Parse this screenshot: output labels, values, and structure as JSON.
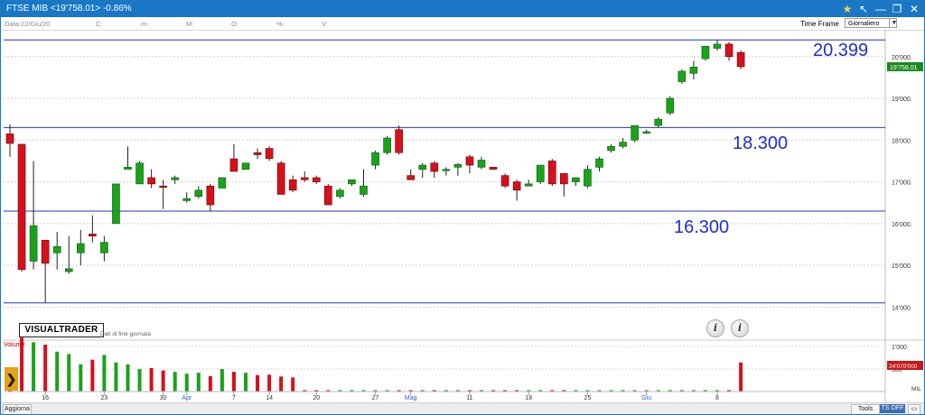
{
  "window": {
    "title": "FTSE MIB <19'758.01> -0.86%",
    "buttons": {
      "star": "★",
      "back": "↖",
      "minimize": "—",
      "restore": "❐",
      "close": "✕"
    }
  },
  "infobar": {
    "date": "Data:22/Giu/20",
    "close": "C:",
    "min": "m:",
    "max": "M:",
    "open": "O:",
    "pct": "%:",
    "vol": "V:"
  },
  "timeframe": {
    "label": "Time Frame",
    "value": "Giornaliero"
  },
  "logo": {
    "text": "VISUALTRADER",
    "subtitle": "Dati di fine giornata"
  },
  "info_buttons": [
    "i",
    "i"
  ],
  "levels": [
    {
      "value": 20399,
      "label": "20.399"
    },
    {
      "value": 18300,
      "label": "18.300"
    },
    {
      "value": 16300,
      "label": "16.300"
    },
    {
      "value": 14100,
      "label": ""
    }
  ],
  "price_axis": {
    "ticks": [
      {
        "v": 20000,
        "label": "20'000."
      },
      {
        "v": 19000,
        "label": "19'000."
      },
      {
        "v": 18000,
        "label": "18'000."
      },
      {
        "v": 17000,
        "label": "17'000."
      },
      {
        "v": 16000,
        "label": "16'000."
      },
      {
        "v": 15000,
        "label": "15'000."
      },
      {
        "v": 14000,
        "label": "14'000."
      }
    ],
    "last_price": "19'758.01"
  },
  "volume_axis": {
    "label": "Volume",
    "ticks": [
      "1'000",
      "500"
    ],
    "unit": "MIL",
    "last_volume": "24'070'000"
  },
  "x_labels": [
    "16",
    "23",
    "30",
    "Apr",
    "7",
    "14",
    "20",
    "27",
    "Mag",
    "11",
    "18",
    "25",
    "Giu",
    "8"
  ],
  "bottombar": {
    "update": "Aggiorna",
    "tools": "Tools",
    "ts": "TS OFF",
    "more": "▭"
  },
  "side_arrow": "❯",
  "chart_data": {
    "type": "candlestick",
    "title": "FTSE MIB",
    "ylim": [
      13900,
      20600
    ],
    "candles": [
      {
        "o": 18150,
        "h": 18380,
        "l": 17600,
        "c": 17920
      },
      {
        "o": 17900,
        "h": 17900,
        "l": 14850,
        "c": 14900
      },
      {
        "o": 15100,
        "h": 17500,
        "l": 14900,
        "c": 15950
      },
      {
        "o": 15600,
        "h": 15600,
        "l": 14100,
        "c": 15050
      },
      {
        "o": 15300,
        "h": 15800,
        "l": 14900,
        "c": 15450
      },
      {
        "o": 14850,
        "h": 15700,
        "l": 14800,
        "c": 14920
      },
      {
        "o": 15300,
        "h": 15850,
        "l": 15000,
        "c": 15520
      },
      {
        "o": 15750,
        "h": 16200,
        "l": 15550,
        "c": 15700
      },
      {
        "o": 15300,
        "h": 15700,
        "l": 15100,
        "c": 15550
      },
      {
        "o": 16000,
        "h": 16950,
        "l": 16000,
        "c": 16950
      },
      {
        "o": 17300,
        "h": 17850,
        "l": 17300,
        "c": 17350
      },
      {
        "o": 16950,
        "h": 17500,
        "l": 16950,
        "c": 17450
      },
      {
        "o": 17100,
        "h": 17300,
        "l": 16850,
        "c": 16950
      },
      {
        "o": 16900,
        "h": 17050,
        "l": 16350,
        "c": 16870
      },
      {
        "o": 17050,
        "h": 17150,
        "l": 16950,
        "c": 17100
      },
      {
        "o": 16550,
        "h": 16750,
        "l": 16500,
        "c": 16600
      },
      {
        "o": 16650,
        "h": 16900,
        "l": 16600,
        "c": 16800
      },
      {
        "o": 16900,
        "h": 16950,
        "l": 16300,
        "c": 16450
      },
      {
        "o": 16850,
        "h": 17100,
        "l": 16850,
        "c": 17100
      },
      {
        "o": 17550,
        "h": 17900,
        "l": 17300,
        "c": 17250
      },
      {
        "o": 17300,
        "h": 17450,
        "l": 17300,
        "c": 17450
      },
      {
        "o": 17700,
        "h": 17800,
        "l": 17550,
        "c": 17650
      },
      {
        "o": 17800,
        "h": 17850,
        "l": 17500,
        "c": 17560
      },
      {
        "o": 17450,
        "h": 17500,
        "l": 16700,
        "c": 16700
      },
      {
        "o": 17050,
        "h": 17150,
        "l": 16750,
        "c": 16800
      },
      {
        "o": 17100,
        "h": 17250,
        "l": 17000,
        "c": 17050
      },
      {
        "o": 17100,
        "h": 17150,
        "l": 16950,
        "c": 17000
      },
      {
        "o": 16900,
        "h": 16950,
        "l": 16450,
        "c": 16450
      },
      {
        "o": 16650,
        "h": 16850,
        "l": 16600,
        "c": 16800
      },
      {
        "o": 16950,
        "h": 17050,
        "l": 16900,
        "c": 17050
      },
      {
        "o": 16700,
        "h": 17300,
        "l": 16650,
        "c": 16900
      },
      {
        "o": 17400,
        "h": 17750,
        "l": 17300,
        "c": 17700
      },
      {
        "o": 17700,
        "h": 18100,
        "l": 17650,
        "c": 18050
      },
      {
        "o": 18250,
        "h": 18350,
        "l": 17650,
        "c": 17700
      },
      {
        "o": 17150,
        "h": 17300,
        "l": 17050,
        "c": 17050
      },
      {
        "o": 17300,
        "h": 17450,
        "l": 17100,
        "c": 17400
      },
      {
        "o": 17450,
        "h": 17500,
        "l": 17100,
        "c": 17250
      },
      {
        "o": 17300,
        "h": 17350,
        "l": 17150,
        "c": 17300
      },
      {
        "o": 17350,
        "h": 17450,
        "l": 17150,
        "c": 17420
      },
      {
        "o": 17600,
        "h": 17650,
        "l": 17200,
        "c": 17400
      },
      {
        "o": 17350,
        "h": 17600,
        "l": 17300,
        "c": 17520
      },
      {
        "o": 17350,
        "h": 17350,
        "l": 17300,
        "c": 17300
      },
      {
        "o": 17150,
        "h": 17200,
        "l": 16850,
        "c": 16900
      },
      {
        "o": 17000,
        "h": 17050,
        "l": 16550,
        "c": 16800
      },
      {
        "o": 16900,
        "h": 17050,
        "l": 16900,
        "c": 16950
      },
      {
        "o": 17000,
        "h": 17400,
        "l": 16950,
        "c": 17400
      },
      {
        "o": 17500,
        "h": 17550,
        "l": 16900,
        "c": 16950
      },
      {
        "o": 17200,
        "h": 17200,
        "l": 16650,
        "c": 16950
      },
      {
        "o": 17000,
        "h": 17100,
        "l": 16900,
        "c": 17100
      },
      {
        "o": 16900,
        "h": 17400,
        "l": 16850,
        "c": 17300
      },
      {
        "o": 17350,
        "h": 17600,
        "l": 17250,
        "c": 17550
      },
      {
        "o": 17750,
        "h": 17900,
        "l": 17700,
        "c": 17850
      },
      {
        "o": 17850,
        "h": 18050,
        "l": 17800,
        "c": 17950
      },
      {
        "o": 18000,
        "h": 18350,
        "l": 17950,
        "c": 18350
      },
      {
        "o": 18200,
        "h": 18250,
        "l": 18150,
        "c": 18200
      },
      {
        "o": 18350,
        "h": 18550,
        "l": 18300,
        "c": 18500
      },
      {
        "o": 18650,
        "h": 19050,
        "l": 18600,
        "c": 19000
      },
      {
        "o": 19400,
        "h": 19700,
        "l": 19350,
        "c": 19650
      },
      {
        "o": 19600,
        "h": 19900,
        "l": 19450,
        "c": 19750
      },
      {
        "o": 19950,
        "h": 20250,
        "l": 19900,
        "c": 20250
      },
      {
        "o": 20200,
        "h": 20400,
        "l": 20150,
        "c": 20300
      },
      {
        "o": 20300,
        "h": 20350,
        "l": 19900,
        "c": 20000
      },
      {
        "o": 20100,
        "h": 20150,
        "l": 19700,
        "c": 19758
      }
    ],
    "volume": [
      0.3,
      1.15,
      1.05,
      1.0,
      0.85,
      0.8,
      0.58,
      0.68,
      0.78,
      0.62,
      0.58,
      0.48,
      0.5,
      0.45,
      0.42,
      0.38,
      0.4,
      0.33,
      0.48,
      0.42,
      0.4,
      0.35,
      0.36,
      0.32,
      0.3,
      0.01,
      0.01,
      0.01,
      0.01,
      0.01,
      0.01,
      0.01,
      0.01,
      0.01,
      0.01,
      0.01,
      0.01,
      0.01,
      0.01,
      0.01,
      0.01,
      0.01,
      0.01,
      0.01,
      0.01,
      0.01,
      0.01,
      0.01,
      0.01,
      0.01,
      0.01,
      0.01,
      0.01,
      0.01,
      0.01,
      0.01,
      0.01,
      0.01,
      0.01,
      0.01,
      0.01,
      0.01,
      0.62
    ]
  }
}
